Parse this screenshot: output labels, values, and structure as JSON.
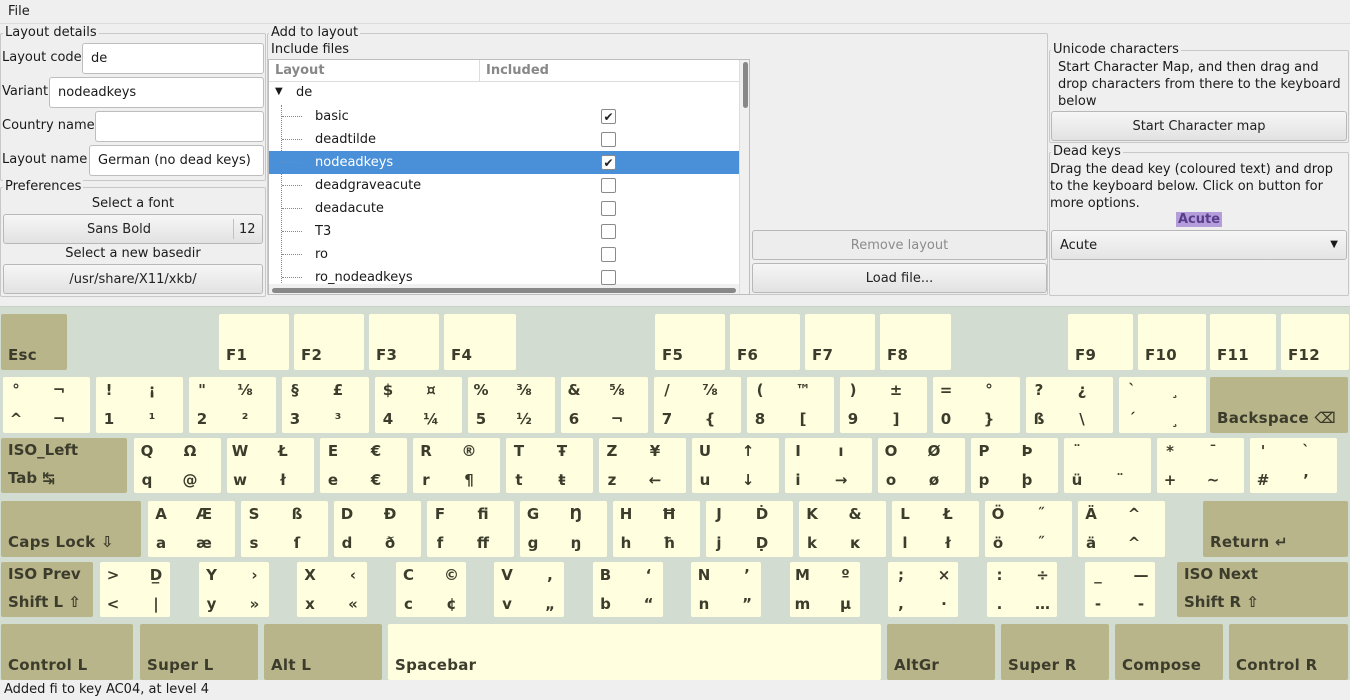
{
  "menu": {
    "file": "File"
  },
  "layout_details": {
    "title": "Layout details",
    "code_label": "Layout code",
    "code_value": "de",
    "variant_label": "Variant",
    "variant_value": "nodeadkeys",
    "country_label": "Country name",
    "country_value": "",
    "name_label": "Layout name",
    "name_value": "German (no dead keys)"
  },
  "preferences": {
    "title": "Preferences",
    "font_label": "Select a font",
    "font_name": "Sans Bold",
    "font_size": "12",
    "basedir_label": "Select a new basedir",
    "basedir_value": "/usr/share/X11/xkb/"
  },
  "add_to_layout": {
    "title": "Add to layout",
    "include_title": "Include files",
    "col_layout": "Layout",
    "col_included": "Included",
    "root": "de",
    "items": [
      {
        "name": "basic",
        "checked": true
      },
      {
        "name": "deadtilde",
        "checked": false
      },
      {
        "name": "nodeadkeys",
        "checked": true,
        "selected": true
      },
      {
        "name": "deadgraveacute",
        "checked": false
      },
      {
        "name": "deadacute",
        "checked": false
      },
      {
        "name": "T3",
        "checked": false
      },
      {
        "name": "ro",
        "checked": false
      },
      {
        "name": "ro_nodeadkeys",
        "checked": false
      }
    ],
    "remove_button": "Remove layout",
    "load_button": "Load file..."
  },
  "unicode": {
    "title": "Unicode characters",
    "text": "Start Character Map, and then drag and drop characters from there to the keyboard below",
    "button": "Start Character map"
  },
  "dead_keys": {
    "title": "Dead keys",
    "text": "Drag the dead key (coloured text) and drop to the keyboard below. Click on button for more options.",
    "label": "Acute",
    "combo_value": "Acute"
  },
  "fkeys": [
    "Esc",
    "F1",
    "F2",
    "F3",
    "F4",
    "F5",
    "F6",
    "F7",
    "F8",
    "F9",
    "F10",
    "F11",
    "F12"
  ],
  "rows": {
    "r1": [
      [
        "°",
        "¬",
        "^",
        "¬"
      ],
      [
        "!",
        "¡",
        "1",
        "¹"
      ],
      [
        "\"",
        "⅛",
        "2",
        "²"
      ],
      [
        "§",
        "£",
        "3",
        "³"
      ],
      [
        "$",
        "¤",
        "4",
        "¼"
      ],
      [
        "%",
        "⅜",
        "5",
        "½"
      ],
      [
        "&",
        "⅝",
        "6",
        "¬"
      ],
      [
        "/",
        "⅞",
        "7",
        "{"
      ],
      [
        "(",
        "™",
        "8",
        "["
      ],
      [
        ")",
        "±",
        "9",
        "]"
      ],
      [
        "=",
        "°",
        "0",
        "}"
      ],
      [
        "?",
        "¿",
        "ß",
        "\\"
      ],
      [
        "`",
        "¸",
        "´",
        "¸"
      ]
    ],
    "r2": [
      [
        "Q",
        "Ω",
        "q",
        "@"
      ],
      [
        "W",
        "Ł",
        "w",
        "ł"
      ],
      [
        "E",
        "€",
        "e",
        "€"
      ],
      [
        "R",
        "®",
        "r",
        "¶"
      ],
      [
        "T",
        "Ŧ",
        "t",
        "ŧ"
      ],
      [
        "Z",
        "¥",
        "z",
        "←"
      ],
      [
        "U",
        "↑",
        "u",
        "↓"
      ],
      [
        "I",
        "ı",
        "i",
        "→"
      ],
      [
        "O",
        "Ø",
        "o",
        "ø"
      ],
      [
        "P",
        "Þ",
        "p",
        "þ"
      ],
      [
        "¨",
        "",
        "ü",
        "¨"
      ],
      [
        "*",
        "¯",
        "+",
        "~"
      ],
      [
        "'",
        "`",
        "#",
        "’"
      ]
    ],
    "r3": [
      [
        "A",
        "Æ",
        "a",
        "æ"
      ],
      [
        "S",
        "ß",
        "s",
        "ſ"
      ],
      [
        "D",
        "Ð",
        "d",
        "ð"
      ],
      [
        "F",
        "ﬁ",
        "f",
        "ﬀ"
      ],
      [
        "G",
        "Ŋ",
        "g",
        "ŋ"
      ],
      [
        "H",
        "Ħ",
        "h",
        "ħ"
      ],
      [
        "J",
        "Ḋ",
        "j",
        "Ḍ"
      ],
      [
        "K",
        "&",
        "k",
        "ĸ"
      ],
      [
        "L",
        "Ł",
        "l",
        "ł"
      ],
      [
        "Ö",
        "˝",
        "ö",
        "˝"
      ],
      [
        "Ä",
        "^",
        "ä",
        "^"
      ]
    ],
    "r4": [
      [
        ">",
        "D̲",
        "<",
        "|"
      ],
      [
        "Y",
        "›",
        "y",
        "»"
      ],
      [
        "X",
        "‹",
        "x",
        "«"
      ],
      [
        "C",
        "©",
        "c",
        "¢"
      ],
      [
        "V",
        ",",
        "v",
        "„"
      ],
      [
        "B",
        "‘",
        "b",
        "“"
      ],
      [
        "N",
        "’",
        "n",
        "”"
      ],
      [
        "M",
        "º",
        "m",
        "µ"
      ],
      [
        ";",
        "×",
        ",",
        "·"
      ],
      [
        ":",
        "÷",
        ".",
        "…"
      ],
      [
        "_",
        "—",
        "-",
        "-"
      ]
    ]
  },
  "mod_keys": {
    "backspace": "Backspace ⌫",
    "tab_top": "ISO_Left",
    "tab_bottom": "Tab ↹",
    "caps": "Caps Lock ⇩",
    "return": "Return ↵",
    "shift_l_top": "ISO Prev",
    "shift_l_bottom": "Shift L ⇧",
    "shift_r_top": "ISO Next",
    "shift_r_bottom": "Shift R ⇧",
    "control_l": "Control L",
    "super_l": "Super L",
    "alt_l": "Alt L",
    "spacebar": "Spacebar",
    "altgr": "AltGr",
    "super_r": "Super R",
    "compose": "Compose",
    "control_r": "Control R"
  },
  "status": "Added ﬁ to key AC04, at level 4",
  "colors": {
    "key": "#ffffe0",
    "mod_key": "#b9b58a",
    "keyboard_bg": "#d3dcd1",
    "selection": "#4a90d9",
    "dead_key_label": "#b39ddb"
  }
}
